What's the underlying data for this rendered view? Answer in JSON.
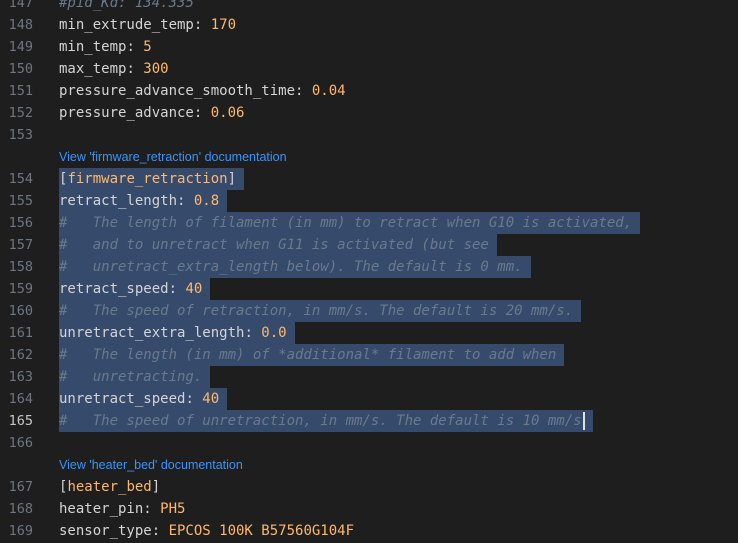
{
  "lines": [
    {
      "num": "147",
      "key": "#pid_Kd",
      "sep": ": ",
      "val": "134.335",
      "type": "comment-kv"
    },
    {
      "num": "148",
      "key": "min_extrude_temp",
      "sep": ": ",
      "val": "170"
    },
    {
      "num": "149",
      "key": "min_temp",
      "sep": ": ",
      "val": "5"
    },
    {
      "num": "150",
      "key": "max_temp",
      "sep": ": ",
      "val": "300"
    },
    {
      "num": "151",
      "key": "pressure_advance_smooth_time",
      "sep": ": ",
      "val": "0.04"
    },
    {
      "num": "152",
      "key": "pressure_advance",
      "sep": ": ",
      "val": "0.06"
    },
    {
      "num": "153"
    },
    {
      "num": "154",
      "section": "firmware_retraction",
      "selected": true
    },
    {
      "num": "155",
      "key": "retract_length",
      "sep": ": ",
      "val": "0.8",
      "selected": true
    },
    {
      "num": "156",
      "comment": "#   The length of filament (in mm) to retract when G10 is activated,",
      "selected": true
    },
    {
      "num": "157",
      "comment": "#   and to unretract when G11 is activated (but see",
      "selected": true
    },
    {
      "num": "158",
      "comment": "#   unretract_extra_length below). The default is 0 mm.",
      "selected": true
    },
    {
      "num": "159",
      "key": "retract_speed",
      "sep": ": ",
      "val": "40",
      "selected": true
    },
    {
      "num": "160",
      "comment": "#   The speed of retraction, in mm/s. The default is 20 mm/s.",
      "selected": true
    },
    {
      "num": "161",
      "key": "unretract_extra_length",
      "sep": ": ",
      "val": "0.0",
      "selected": true
    },
    {
      "num": "162",
      "comment": "#   The length (in mm) of *additional* filament to add when",
      "selected": true
    },
    {
      "num": "163",
      "comment": "#   unretracting.",
      "selected": true
    },
    {
      "num": "164",
      "key": "unretract_speed",
      "sep": ": ",
      "val": "40",
      "selected": true
    },
    {
      "num": "165",
      "comment": "#   The speed of unretraction, in mm/s. The default is 10 mm/s",
      "selected": true,
      "active": true,
      "cursor": true
    },
    {
      "num": "166"
    },
    {
      "num": "167",
      "section": "heater_bed"
    },
    {
      "num": "168",
      "key": "heater_pin",
      "sep": ": ",
      "val": "PH5"
    },
    {
      "num": "169",
      "key": "sensor_type",
      "sep": ": ",
      "val": "EPCOS 100K B57560G104F"
    }
  ],
  "codelens": [
    {
      "text": "View 'firmware_retraction' documentation",
      "before": "154"
    },
    {
      "text": "View 'heater_bed' documentation",
      "before": "167"
    }
  ],
  "colors": {
    "background": "#1e1e1e",
    "selection": "#364a6b",
    "value": "#ffb86c",
    "comment": "#6a7a8c",
    "link": "#3794ff"
  }
}
